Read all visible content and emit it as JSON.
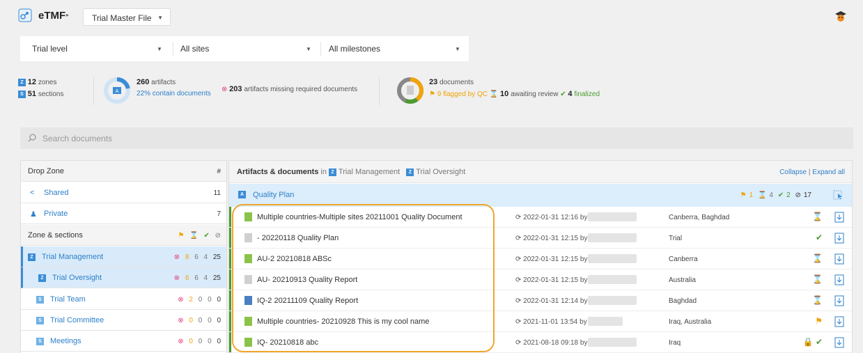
{
  "topbar": {
    "app_name": "eTMF",
    "app_caret": "▸",
    "tmf_select": "Trial Master File",
    "logo_icon": "molecule-logo-icon",
    "user_icon": "graduation-cap-icon"
  },
  "filters": {
    "level": "Trial level",
    "sites": "All sites",
    "milestones": "All milestones"
  },
  "stats": {
    "zones_count": "12",
    "zones_label": "zones",
    "sections_count": "51",
    "sections_label": "sections",
    "artifacts_count": "260",
    "artifacts_label": "artifacts",
    "contain_pct": "22%",
    "contain_label": "contain documents",
    "missing_count": "203",
    "missing_label": "artifacts missing required documents",
    "documents_count": "23",
    "documents_label": "documents",
    "flagged_count": "9",
    "flagged_label": "flagged by QC",
    "awaiting_count": "10",
    "awaiting_label": "awaiting review",
    "finalized_count": "4",
    "finalized_label": "finalized",
    "artifacts_ring_fraction": 0.22
  },
  "search": {
    "placeholder": "Search documents"
  },
  "left_panel": {
    "drop_zone_header": "Drop Zone",
    "count_header": "#",
    "shared_label": "Shared",
    "shared_count": "11",
    "private_label": "Private",
    "private_count": "7",
    "zones_header": "Zone & sections",
    "items": [
      {
        "label": "Trial Management",
        "c1": "8",
        "c2": "6",
        "c3": "4",
        "c4": "25"
      },
      {
        "label": "Trial Oversight",
        "c1": "6",
        "c2": "6",
        "c3": "4",
        "c4": "25"
      },
      {
        "label": "Trial Team",
        "c1": "2",
        "c2": "0",
        "c3": "0",
        "c4": "0"
      },
      {
        "label": "Trial Committee",
        "c1": "0",
        "c2": "0",
        "c3": "0",
        "c4": "0"
      },
      {
        "label": "Meetings",
        "c1": "0",
        "c2": "0",
        "c3": "0",
        "c4": "0"
      }
    ]
  },
  "right_panel": {
    "header_prefix": "Artifacts & documents",
    "header_in": "in",
    "crumb1": "Trial Management",
    "crumb2": "Trial Oversight",
    "collapse": "Collapse",
    "sep": "|",
    "expand": "Expand all",
    "artifact": {
      "title": "Quality Plan",
      "flag_count": "1",
      "hourglass_count": "4",
      "check_count": "2",
      "none_count": "17"
    },
    "documents": [
      {
        "name": "Multiple countries-Multiple sites 20211001 Quality Document",
        "date": "⟳ 2022-01-31 12:16 by",
        "site": "Canberra, Baghdad",
        "status": "hourglass",
        "icon": "green"
      },
      {
        "name": "- 20220118 Quality Plan",
        "date": "⟳ 2022-01-31 12:15 by",
        "site": "Trial",
        "status": "check",
        "icon": "grey"
      },
      {
        "name": "AU-2 20210818 ABSc",
        "date": "⟳ 2022-01-31 12:15 by",
        "site": "Canberra",
        "status": "hourglass",
        "icon": "green"
      },
      {
        "name": "AU- 20210913 Quality Report",
        "date": "⟳ 2022-01-31 12:15 by",
        "site": "Australia",
        "status": "hourglass",
        "icon": "grey"
      },
      {
        "name": "IQ-2 20211109 Quality Report",
        "date": "⟳ 2022-01-31 12:14 by",
        "site": "Baghdad",
        "status": "hourglass",
        "icon": "word"
      },
      {
        "name": "Multiple countries- 20210928 This is my cool name",
        "date": "⟳ 2021-11-01 13:54 by",
        "site": "Iraq, Australia",
        "status": "flag",
        "icon": "green"
      },
      {
        "name": "IQ- 20210818 abc",
        "date": "⟳ 2021-08-18 09:18 by",
        "site": "Iraq",
        "status": "lock-check",
        "icon": "green"
      }
    ]
  },
  "colors": {
    "accent": "#2d7fc9",
    "flag": "#f0a30a",
    "check": "#4b9b2f",
    "missing": "#e0457b",
    "highlight": "#f0a52b"
  }
}
